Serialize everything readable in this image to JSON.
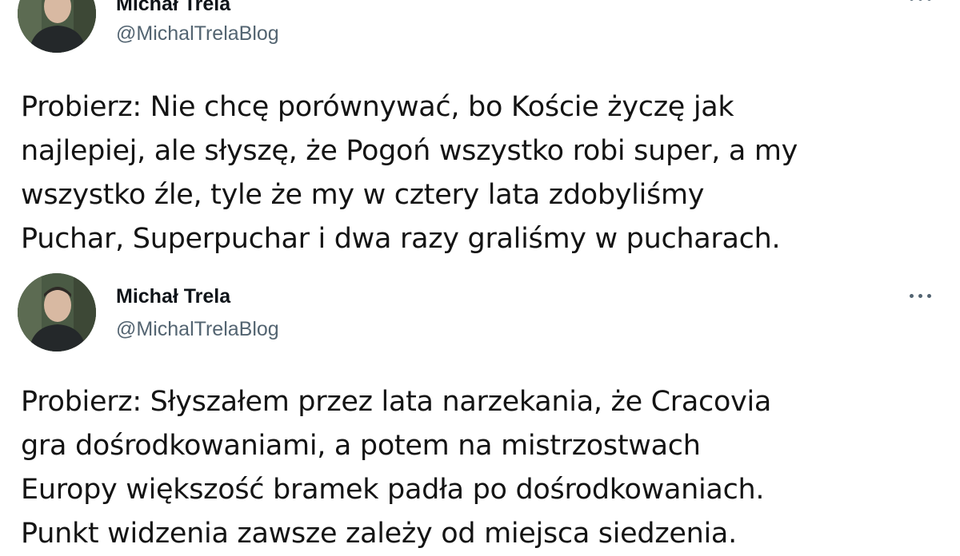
{
  "tweets": [
    {
      "author_name": "Michał Trela",
      "author_handle": "@MichalTrelaBlog",
      "lines": [
        "Probierz: Nie chcę porównywać, bo Koście życzę jak",
        "najlepiej, ale słyszę, że Pogoń wszystko robi super, a my",
        "wszystko źle, tyle że my w cztery lata zdobyliśmy",
        "Puchar, Superpuchar i dwa razy graliśmy w pucharach."
      ]
    },
    {
      "author_name": "Michał Trela",
      "author_handle": "@MichalTrelaBlog",
      "more_icon": "more-horizontal-icon",
      "lines": [
        "Probierz: Słyszałem przez lata narzekania, że Cracovia",
        "gra dośrodkowaniami, a potem na mistrzostwach",
        "Europy większość bramek padła po dośrodkowaniach.",
        "Punkt widzenia zawsze zależy od miejsca siedzenia."
      ]
    }
  ],
  "colors": {
    "text": "#141414",
    "handle": "#536471",
    "background": "#ffffff"
  }
}
